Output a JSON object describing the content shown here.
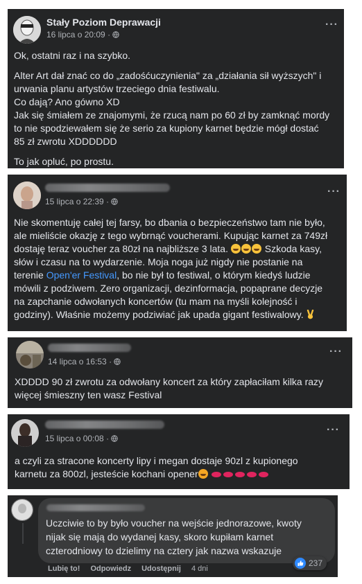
{
  "posts": [
    {
      "author": "Stały Poziom Deprawacji",
      "date": "16 lipca o 20:09 ·",
      "lines": [
        "Ok, ostatni raz i na szybko.",
        "Alter Art dał znać co do „zadośćuczynienia\" za „działania sił wyższych\" i",
        "urwania planu artystów trzeciego dnia festiwalu.",
        "Co dają? Ano gówno XD",
        "Jak się śmiałem ze znajomymi, że rzucą nam po 60 zł by zamknąć mordy",
        "to nie spodziewałem się że serio za kupiony karnet będzie mógł dostać",
        "85 zł zwrotu XDDDDDD",
        "To jak opluć, po prostu."
      ]
    },
    {
      "date": "15 lipca o 22:39 ·",
      "lines": [
        "Nie skomentuję całej tej farsy, bo dbania o bezpieczeństwo tam nie było,",
        "ale mieliście okazję z tego wybrnąć voucherami. Kupując karnet za 749zł",
        "dostaję teraz voucher za 80zł na najbliższe 3 lata.",
        "Szkoda kasy,",
        "słów i czasu na to wydarzenie. Moja noga już nigdy nie postanie na",
        "terenie",
        "Open'er Festival",
        ", bo nie był to festiwal, o którym kiedyś ludzie",
        "mówili z podziwem. Zero organizacji, dezinformacja, popaprane decyzje",
        "na zapchanie odwołanych koncertów (tu mam na myśli kolejność i",
        "godziny). Właśnie możemy podziwiać jak upada gigant festiwalowy."
      ]
    },
    {
      "date": "14 lipca o 16:53 ·",
      "lines": [
        "XDDDD 90 zł zwrotu za odwołany koncert za który zapłaciłam kilka razy",
        "więcej śmieszny ten wasz Festival"
      ]
    },
    {
      "date": "15 lipca o 00:08 ·",
      "lines": [
        "a czyli za stracone koncerty lipy i megan dostaje 90zl z kupionego",
        "karnetu za 800zl, jesteście kochani opener"
      ]
    }
  ],
  "comment": {
    "lines": [
      "Uczciwie to by było voucher na wejście jednorazowe, kwoty",
      "nijak się mają do wydanej kasy, skoro kupiłam karnet",
      "czterodniowy to dzielimy na cztery jak nazwa wskazuje"
    ],
    "reaction_count": "237",
    "like_label": "Lubię to!",
    "reply_label": "Odpowiedz",
    "share_label": "Udostępnij",
    "time_label": "4 dni"
  },
  "icons": {
    "more": "more-options-icon",
    "globe": "globe-icon",
    "like_reaction": "like-reaction-icon",
    "emoji_laugh": "rofl-emoji-icon",
    "emoji_kiss": "kiss-lips-emoji-icon",
    "emoji_devil": "smiling-face-hearts-emoji-icon",
    "emoji_victory": "victory-hand-emoji-icon"
  },
  "colors": {
    "card_bg": "#242526",
    "text": "#e4e6eb",
    "secondary_text": "#b0b3b8",
    "link": "#4599ff",
    "like_blue": "#2e89ff"
  }
}
